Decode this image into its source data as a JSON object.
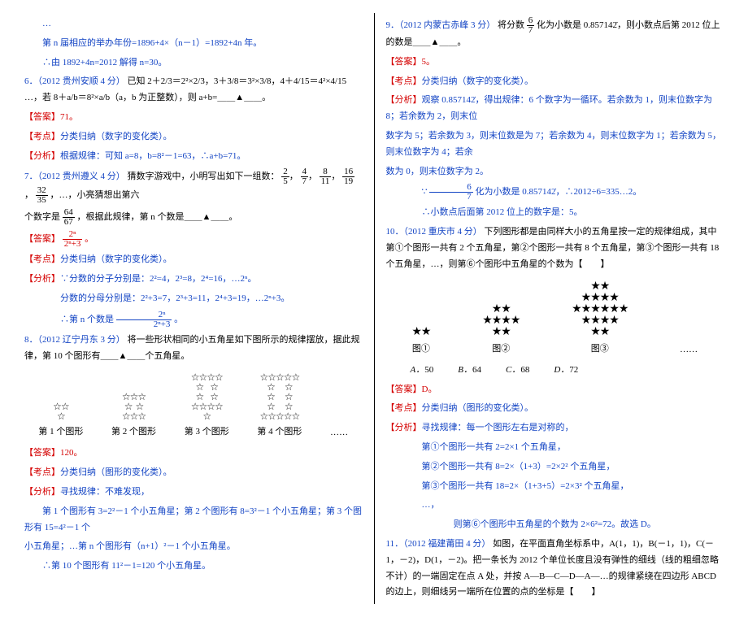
{
  "left": {
    "line1": "…",
    "line2": "第 n 届相应的举办年份=1896+4×（n－1）=1892+4n 年。",
    "line3": "∴由 1892+4n=2012 解得 n=30。",
    "q6_head": "6．（2012 贵州安顺 4 分）",
    "q6_body": "已知 2＋2/3＝2²×2/3，3＋3/8＝3²×3/8，4＋4/15＝4²×4/15 …，若 8＋a/b＝8²×a/b（a，b 为正整数），则 a+b=＿＿▲＿＿。",
    "q6_ans_l": "【答案】",
    "q6_ans": "71。",
    "q6_kd_l": "【考点】",
    "q6_kd": "分类归纳（数字的变化类）。",
    "q6_fx_l": "【分析】",
    "q6_fx": "根据规律：可知 a=8，b=8²－1=63，∴a+b=71。",
    "q7_head": "7．（2012 贵州遵义 4 分）",
    "q7_body_a": "猜数字游戏中，小明写出如下一组数：",
    "q7_body_b": "，…，小亮猜想出第六",
    "q7_frac1_n": "2",
    "q7_frac1_d": "5",
    "q7_frac2_n": "4",
    "q7_frac2_d": "7",
    "q7_frac3_n": "8",
    "q7_frac3_d": "11",
    "q7_frac4_n": "16",
    "q7_frac4_d": "19",
    "q7_frac5_n": "32",
    "q7_frac5_d": "35",
    "q7_body2_a": "个数字是",
    "q7_body2_b": "，根据此规律，第 n 个数是＿＿▲＿＿。",
    "q7_frac6_n": "64",
    "q7_frac6_d": "67",
    "q7_ans_l": "【答案】",
    "q7_ans_num": "2ⁿ",
    "q7_ans_den": "2ⁿ+3",
    "q7_ans_tail": "。",
    "q7_kd_l": "【考点】",
    "q7_kd": "分类归纳（数字的变化类）。",
    "q7_fx_l": "【分析】",
    "q7_fx1": "∵分数的分子分别是：2²=4，2³=8，2⁴=16，…2ⁿ。",
    "q7_fx2": "分数的分母分别是：2²+3=7，2³+3=11，2⁴+3=19，…2ⁿ+3。",
    "q7_fx3a": "∴第 n 个数是",
    "q7_fx3b": "。",
    "q8_head": "8．（2012 辽宁丹东 3 分）",
    "q8_body": "将一些形状相同的小五角星如下图所示的规律摆放，据此规律，第 10 个图形有＿＿▲＿＿个五角星。",
    "fig_c1": "第 1 个图形",
    "fig_c2": "第 2 个图形",
    "fig_c3": "第 3 个图形",
    "fig_c4": "第 4 个图形",
    "fig_dots": "……",
    "q8_ans_l": "【答案】",
    "q8_ans": "120。",
    "q8_kd_l": "【考点】",
    "q8_kd": "分类归纳（图形的变化类）。",
    "q8_fx_l": "【分析】",
    "q8_fx0": "寻找规律：不难发现，",
    "q8_fx1": "第 1 个图形有 3=2²－1 个小五角星；第 2 个图形有 8=3²－1 个小五角星；第 3 个图形有 15=4²－1 个",
    "q8_fx2": "小五角星；…第 n 个图形有（n+1）²－1 个小五角星。",
    "q8_fx3": "∴第 10 个图形有 11²－1=120 个小五角星。"
  },
  "right": {
    "q9_head": "9．（2012 内蒙古赤峰 3 分）",
    "q9_body_a": "将分数",
    "q9_body_b": "化为小数是 0.857142̇，则小数点后第 2012 位上的数是＿＿▲＿＿。",
    "q9_frac_n": "6",
    "q9_frac_d": "7",
    "q9_ans_l": "【答案】",
    "q9_ans": "5。",
    "q9_kd_l": "【考点】",
    "q9_kd": "分类归纳（数字的变化类）。",
    "q9_fx_l": "【分析】",
    "q9_fx0": "观察 0.857142̇，得出规律：6 个数字为一循环。若余数为 1，则末位数字为 8；若余数为 2，则末位",
    "q9_fx1": "数字为 5；若余数为 3，则末位数是为 7；若余数为 4，则末位数字为 1；若余数为 5，则末位数字为 4；若余",
    "q9_fx2": "数为 0，则末位数字为 2。",
    "q9_fx3a": "∵",
    "q9_fx3b": "化为小数是 0.857142̇，∴2012÷6=335…2。",
    "q9_fx4": "∴小数点后面第 2012 位上的数字是：5。",
    "q10_head": "10．（2012 重庆市 4 分）",
    "q10_body": "下列图形都是由同样大小的五角星按一定的规律组成，其中第①个图形一共有 2 个五角星，第②个图形一共有 8 个五角星，第③个图形一共有 18 个五角星，…，则第⑥个图形中五角星的个数为【　　】",
    "fig_t1": "图①",
    "fig_t2": "图②",
    "fig_t3": "图③",
    "fig_dots": "……",
    "optA": "50",
    "optB": "64",
    "optC": "68",
    "optD": "72",
    "q10_ans_l": "【答案】",
    "q10_ans": "D。",
    "q10_kd_l": "【考点】",
    "q10_kd": "分类归纳（图形的变化类）。",
    "q10_fx_l": "【分析】",
    "q10_fx0": "寻找规律：每一个图形左右是对称的，",
    "q10_fx1": "第①个图形一共有 2=2×1 个五角星，",
    "q10_fx2": "第②个图形一共有 8=2×（1+3）=2×2² 个五角星，",
    "q10_fx3": "第③个图形一共有 18=2×（1+3+5）=2×3² 个五角星，",
    "q10_fx4": "…，",
    "q10_fx5": "则第⑥个图形中五角星的个数为 2×6²=72。故选 D。",
    "q11_head": "11．（2012 福建莆田 4 分）",
    "q11_body": "如图，在平面直角坐标系中，A(1，1)，B(－1，1)，C(－1，－2)，D(1，－2)。把一条长为 2012 个单位长度且没有弹性的细线（线的粗细忽略不计）的一端固定在点 A 处，并按 A—B—C—D—A—…的规律紧绕在四边形 ABCD 的边上，则细线另一端所在位置的点的坐标是【　　】"
  }
}
